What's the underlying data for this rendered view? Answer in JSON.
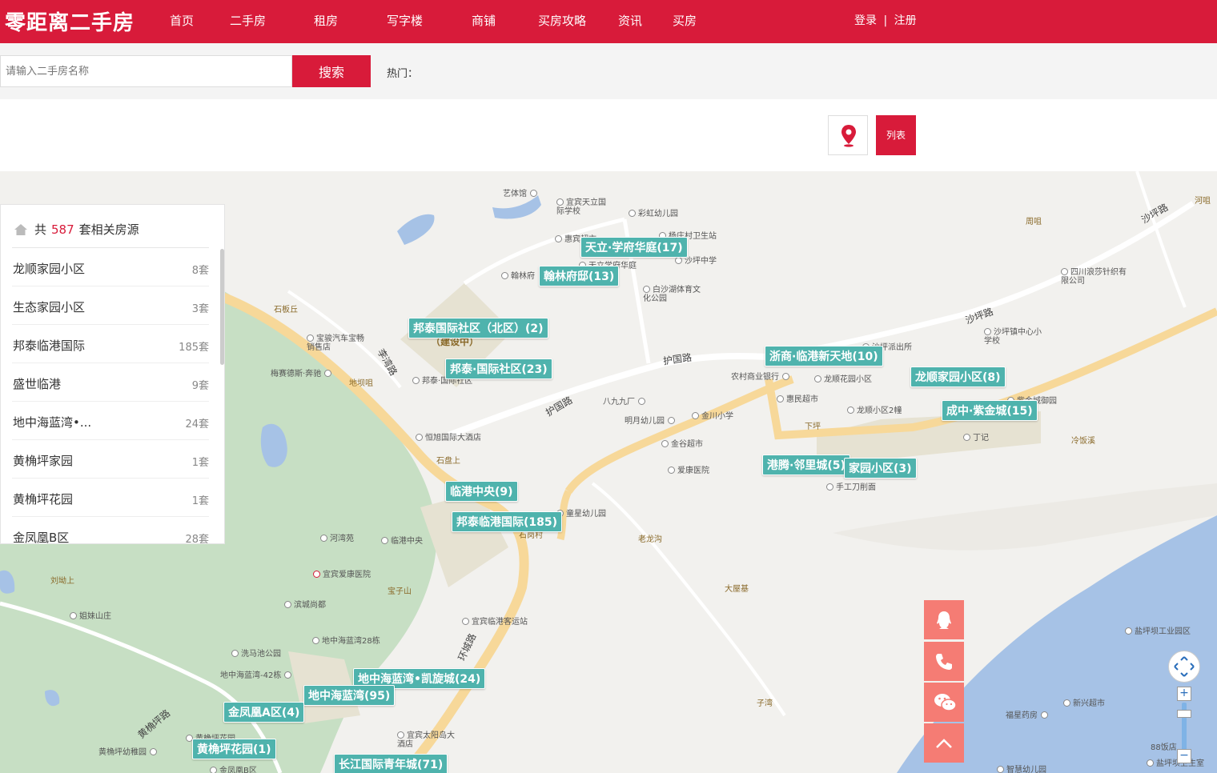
{
  "header": {
    "logo": "零距离二手房",
    "nav": [
      "首页",
      "二手房",
      "租房",
      "写字楼",
      "商铺",
      "买房攻略",
      "资讯",
      "买房"
    ],
    "login": "登录",
    "divider": "|",
    "register": "注册",
    "brand_color": "#d81b3a"
  },
  "search": {
    "placeholder": "请输入二手房名称",
    "button": "搜索",
    "hot_label": "热门："
  },
  "toolbar": {
    "location_icon": "map-pin-icon",
    "list_button": "列表"
  },
  "panel": {
    "prefix": "共",
    "total": "587",
    "suffix": "套相关房源",
    "items": [
      {
        "name": "龙顺家园小区",
        "count": "8套"
      },
      {
        "name": "生态家园小区",
        "count": "3套"
      },
      {
        "name": "邦泰临港国际",
        "count": "185套"
      },
      {
        "name": "盛世临港",
        "count": "9套"
      },
      {
        "name": "地中海蓝湾•...",
        "count": "24套"
      },
      {
        "name": "黄桷坪家园",
        "count": "1套"
      },
      {
        "name": "黄桷坪花园",
        "count": "1套"
      },
      {
        "name": "金凤凰B区",
        "count": "28套"
      }
    ]
  },
  "map": {
    "markers": [
      "天立·学府华庭(17)",
      "翰林府邸(13)",
      "邦泰国际社区（北区）(2)",
      "邦泰·国际社区(23)",
      "浙商·临港新天地(10)",
      "龙顺家园小区(8)",
      "成中·紫金城(15)",
      "港腾·邻里城(5)",
      "家园小区(3)",
      "临港中央(9)",
      "邦泰临港国际(185)",
      "地中海蓝湾•凯旋城(24)",
      "地中海蓝湾(95)",
      "金凤凰A区(4)",
      "黄桷坪花园(1)",
      "长江国际青年城(71)"
    ],
    "roads": [
      "护国路",
      "护国路",
      "沙坪路",
      "沙坪路",
      "李湾路",
      "环城路",
      "黄桷坪路"
    ],
    "places": [
      "石板丘",
      "地坝咀",
      "石盘上",
      "宝子山",
      "老龙沟",
      "大屋基",
      "刘坳上",
      "子湾",
      "周咀",
      "冷饭溪",
      "下坪",
      "石岗村",
      "（建设中）",
      "河咀"
    ],
    "pois": [
      "艺体馆",
      "宜宾天立国际学校",
      "彩虹幼儿园",
      "惠宾超市",
      "杨庄村卫生站",
      "沙坪中学",
      "翰林府",
      "天立学府华庭",
      "白沙湖体育文化公园",
      "宝骏汽车宝畅销售店",
      "梅赛德斯·奔驰",
      "邦泰·国际社区",
      "恒旭国际大酒店",
      "沙坪派出所",
      "沙坪镇中心小学校",
      "四川浪莎针织有限公司",
      "农村商业银行",
      "龙顺花园小区",
      "惠民超市",
      "龙顺小区2幢",
      "八九九厂",
      "明月幼儿园",
      "金川小学",
      "金谷超市",
      "爱康医院",
      "丁记",
      "紫金城御园",
      "手工刀削面",
      "童星幼儿园",
      "河湾苑",
      "临港中央",
      "宜宾爱康医院",
      "滨城尚都",
      "宜宾临港客运站",
      "地中海蓝湾28栋",
      "洗马池公园",
      "地中海蓝湾-42栋",
      "姐妹山庄",
      "黄桷坪花园",
      "黄桷坪幼稚园",
      "宜宾太阳岛大酒店",
      "金凤凰B区",
      "盐坪坝工业园区",
      "新兴超市",
      "福星药房",
      "88饭店",
      "盐坪坝卫生室",
      "智慧幼儿园"
    ],
    "water_color": "#a6c2e6",
    "park_color": "#c7dfc4"
  },
  "float_buttons": [
    "qq-icon",
    "phone-icon",
    "wechat-icon",
    "back-to-top-icon"
  ],
  "zoom": {
    "in": "+",
    "out": "−"
  }
}
